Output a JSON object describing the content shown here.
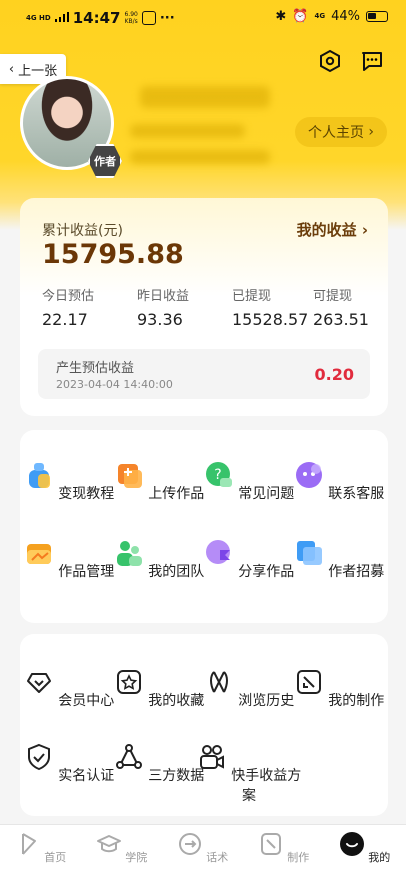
{
  "status": {
    "network": "4G HD",
    "time": "14:47",
    "speed": "6.90",
    "speed_unit": "KB/s",
    "battery": "44%"
  },
  "nav": {
    "back_label": "上一张"
  },
  "profile": {
    "homepage_label": "个人主页",
    "badge": "作者"
  },
  "earnings": {
    "label": "累计收益(元)",
    "total": "15795.88",
    "my_earnings": "我的收益",
    "stats": [
      {
        "label": "今日预估",
        "value": "22.17"
      },
      {
        "label": "昨日收益",
        "value": "93.36"
      },
      {
        "label": "已提现",
        "value": "15528.57"
      },
      {
        "label": "可提现",
        "value": "263.51"
      }
    ],
    "pending": {
      "title": "产生预估收益",
      "datetime": "2023-04-04 14:40:00",
      "value": "0.20"
    }
  },
  "grid1": [
    {
      "label": "变现教程",
      "icon": "money-bag-icon",
      "color": "#3f9cf5"
    },
    {
      "label": "上传作品",
      "icon": "upload-icon",
      "color": "#f5842a"
    },
    {
      "label": "常见问题",
      "icon": "question-icon",
      "color": "#37c36b"
    },
    {
      "label": "联系客服",
      "icon": "chat-bubble-icon",
      "color": "#9b6cf5"
    },
    {
      "label": "作品管理",
      "icon": "folder-icon",
      "color": "#f5a11f"
    },
    {
      "label": "我的团队",
      "icon": "team-icon",
      "color": "#37c36b"
    },
    {
      "label": "分享作品",
      "icon": "share-icon",
      "color": "#9b6cf5"
    },
    {
      "label": "作者招募",
      "icon": "recruit-icon",
      "color": "#3f9cf5"
    }
  ],
  "grid2": [
    {
      "label": "会员中心",
      "icon": "vip-icon"
    },
    {
      "label": "我的收藏",
      "icon": "favorite-icon"
    },
    {
      "label": "浏览历史",
      "icon": "history-icon"
    },
    {
      "label": "我的制作",
      "icon": "creation-icon"
    },
    {
      "label": "实名认证",
      "icon": "verify-icon"
    },
    {
      "label": "三方数据",
      "icon": "data-icon"
    },
    {
      "label": "快手收益方案",
      "icon": "video-camera-icon"
    }
  ],
  "tabs": [
    {
      "label": "首页",
      "icon": "home-icon"
    },
    {
      "label": "学院",
      "icon": "academy-icon"
    },
    {
      "label": "话术",
      "icon": "script-icon"
    },
    {
      "label": "制作",
      "icon": "make-icon"
    },
    {
      "label": "我的",
      "icon": "me-icon",
      "active": true
    }
  ]
}
